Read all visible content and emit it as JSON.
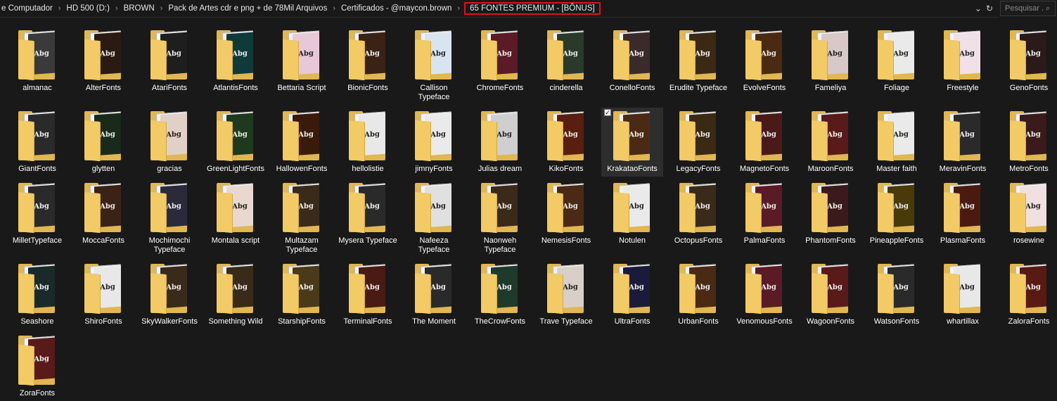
{
  "breadcrumb": {
    "items": [
      "e Computador",
      "HD 500 (D:)",
      "BROWN",
      "Pack de Artes cdr e png + de 78Mil Arquivos",
      "Certificados - @maycon.brown"
    ],
    "current": "65 FONTES PREMIUM - [BÔNUS]"
  },
  "search": {
    "placeholder": "Pesquisar ..."
  },
  "colors": {
    "highlight_border": "#e0101a",
    "folder": "#e2b650",
    "background": "#191919"
  },
  "folders": [
    {
      "name": "almanac",
      "art": "#3a3a3a"
    },
    {
      "name": "AlterFonts",
      "art": "#2a1a12"
    },
    {
      "name": "AtariFonts",
      "art": "#1e1e1e"
    },
    {
      "name": "AtlantisFonts",
      "art": "#103a3a"
    },
    {
      "name": "Bettaria Script",
      "art": "#e8c8d8"
    },
    {
      "name": "BionicFonts",
      "art": "#3a2216"
    },
    {
      "name": "Callison Typeface",
      "art": "#d8e4f0"
    },
    {
      "name": "ChromeFonts",
      "art": "#5a1a26"
    },
    {
      "name": "cinderella",
      "art": "#2a3a2a"
    },
    {
      "name": "ConelloFonts",
      "art": "#3a2a2a"
    },
    {
      "name": "Erudite Typeface",
      "art": "#3a2a14"
    },
    {
      "name": "EvolveFonts",
      "art": "#4a2a10"
    },
    {
      "name": "Fameliya",
      "art": "#d8c8c8"
    },
    {
      "name": "Foliage",
      "art": "#eaeaea"
    },
    {
      "name": "Freestyle",
      "art": "#f0e0e8"
    },
    {
      "name": "GenoFonts",
      "art": "#2a1a1a"
    },
    {
      "name": "GiantFonts",
      "art": "#2a2a2a"
    },
    {
      "name": "glytten",
      "art": "#1a2a1a"
    },
    {
      "name": "gracias",
      "art": "#e0d0c8"
    },
    {
      "name": "GreenLightFonts",
      "art": "#1e3a1e"
    },
    {
      "name": "HallowenFonts",
      "art": "#3a1a0a"
    },
    {
      "name": "hellolistie",
      "art": "#e8e8e8"
    },
    {
      "name": "jimnyFonts",
      "art": "#eaeaea"
    },
    {
      "name": "Julias dream",
      "art": "#cfcfcf"
    },
    {
      "name": "KikoFonts",
      "art": "#5a1e0e"
    },
    {
      "name": "KrakataoFonts",
      "art": "#4a2a14"
    },
    {
      "name": "LegacyFonts",
      "art": "#3a2a14"
    },
    {
      "name": "MagnetoFonts",
      "art": "#4a1a1a"
    },
    {
      "name": "MaroonFonts",
      "art": "#5a1a1a"
    },
    {
      "name": "Master faith",
      "art": "#eaeaea"
    },
    {
      "name": "MeravinFonts",
      "art": "#2a2a2a"
    },
    {
      "name": "MetroFonts",
      "art": "#3a1a1a"
    },
    {
      "name": "MilletTypeface",
      "art": "#2a2a2a"
    },
    {
      "name": "MoccaFonts",
      "art": "#3a2216"
    },
    {
      "name": "Mochimochi Typeface",
      "art": "#2a2a3a"
    },
    {
      "name": "Montala script",
      "art": "#e8d8d0"
    },
    {
      "name": "Multazam Typeface",
      "art": "#3a2a1a"
    },
    {
      "name": "Mysera Typeface",
      "art": "#2a2a2a"
    },
    {
      "name": "Nafeeza Typeface",
      "art": "#e0e0e0"
    },
    {
      "name": "Naonweh Typeface",
      "art": "#3a2a1a"
    },
    {
      "name": "NemesisFonts",
      "art": "#4a2a14"
    },
    {
      "name": "Notulen",
      "art": "#eaeaea"
    },
    {
      "name": "OctopusFonts",
      "art": "#3a2a1a"
    },
    {
      "name": "PalmaFonts",
      "art": "#5a1a26"
    },
    {
      "name": "PhantomFonts",
      "art": "#3a1a1a"
    },
    {
      "name": "PineappleFonts",
      "art": "#4a3a0a"
    },
    {
      "name": "PlasmaFonts",
      "art": "#4a1a10"
    },
    {
      "name": "rosewine",
      "art": "#f0e0e0"
    },
    {
      "name": "Seashore",
      "art": "#1a2a2a"
    },
    {
      "name": "ShiroFonts",
      "art": "#e8e8e8"
    },
    {
      "name": "SkyWalkerFonts",
      "art": "#3a2a1a"
    },
    {
      "name": "Something Wild",
      "art": "#3a2a1a"
    },
    {
      "name": "StarshipFonts",
      "art": "#4a3a1a"
    },
    {
      "name": "TerminalFonts",
      "art": "#4a1a14"
    },
    {
      "name": "The Moment",
      "art": "#2a2a2a"
    },
    {
      "name": "TheCrowFonts",
      "art": "#1e3a2a"
    },
    {
      "name": "Trave Typeface",
      "art": "#d8d0c8"
    },
    {
      "name": "UltraFonts",
      "art": "#1a1a3a"
    },
    {
      "name": "UrbanFonts",
      "art": "#4a2a14"
    },
    {
      "name": "VenomousFonts",
      "art": "#5a1a26"
    },
    {
      "name": "WagoonFonts",
      "art": "#5a1a1a"
    },
    {
      "name": "WatsonFonts",
      "art": "#2a2a2a"
    },
    {
      "name": "whartillax",
      "art": "#e8e8e8"
    },
    {
      "name": "ZaloraFonts",
      "art": "#5a1a14"
    },
    {
      "name": "ZoraFonts",
      "art": "#5a1a1a"
    }
  ],
  "selected_index": 25
}
